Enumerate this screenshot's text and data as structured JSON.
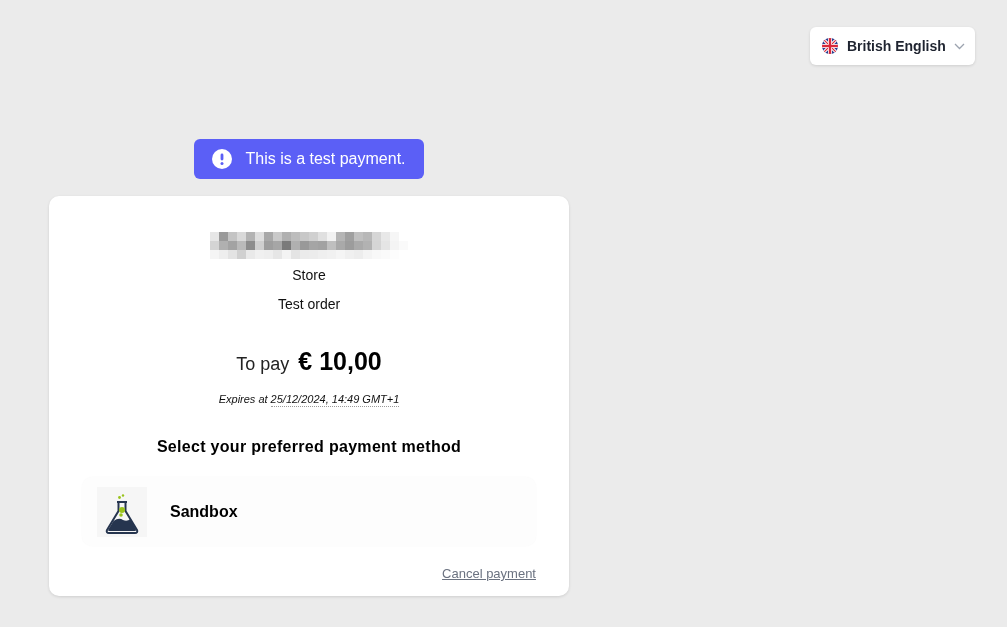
{
  "language_selector": {
    "label": "British English"
  },
  "banner": {
    "text": "This is a test payment."
  },
  "order": {
    "merchant_type": "Store",
    "description": "Test order",
    "amount_label": "To pay",
    "amount": "€ 10,00",
    "expiry_label": "Expires at",
    "expiry_date": "25/12/2024, 14:49 GMT+1"
  },
  "payment_section": {
    "heading": "Select your preferred payment method",
    "methods": [
      {
        "name": "Sandbox"
      }
    ]
  },
  "cancel_link": "Cancel payment"
}
